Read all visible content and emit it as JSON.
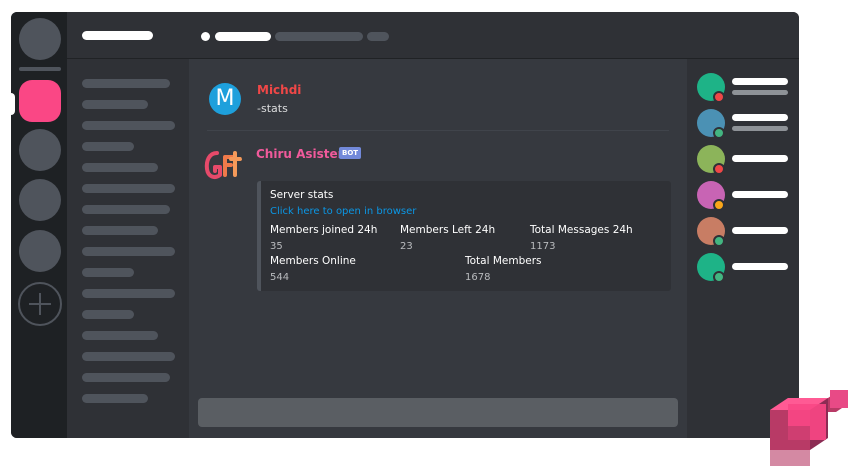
{
  "message_user": {
    "name": "Michdi",
    "avatar_letter": "M",
    "text": "-stats",
    "name_color": "#f04747",
    "avatar_color": "#1ea0dc"
  },
  "bot": {
    "name": "Chiru Asistente",
    "badge": "BOT",
    "name_color": "#f05a9b",
    "embed": {
      "title": "Server stats",
      "link": "Click here to open in browser",
      "fields": [
        {
          "name": "Members joined 24h",
          "value": "35"
        },
        {
          "name": "Members Left 24h",
          "value": "23"
        },
        {
          "name": "Total Messages 24h",
          "value": "1173"
        },
        {
          "name": "Members Online",
          "value": "544"
        },
        {
          "name": "Total Members",
          "value": "1678"
        }
      ]
    }
  },
  "colors": {
    "accent_pink": "#fa4785",
    "online": "#43b581",
    "idle": "#faa61a",
    "dnd": "#f04747"
  },
  "members": [
    {
      "avatar_color": "#1eb387",
      "status": "dnd",
      "has_subtitle": true
    },
    {
      "avatar_color": "#4b91b4",
      "status": "online",
      "has_subtitle": true
    },
    {
      "avatar_color": "#8cb45a",
      "status": "dnd",
      "has_subtitle": false
    },
    {
      "avatar_color": "#c864b4",
      "status": "idle",
      "has_subtitle": false
    },
    {
      "avatar_color": "#c87d64",
      "status": "online",
      "has_subtitle": false
    },
    {
      "avatar_color": "#1eb387",
      "status": "online",
      "has_subtitle": false
    }
  ]
}
